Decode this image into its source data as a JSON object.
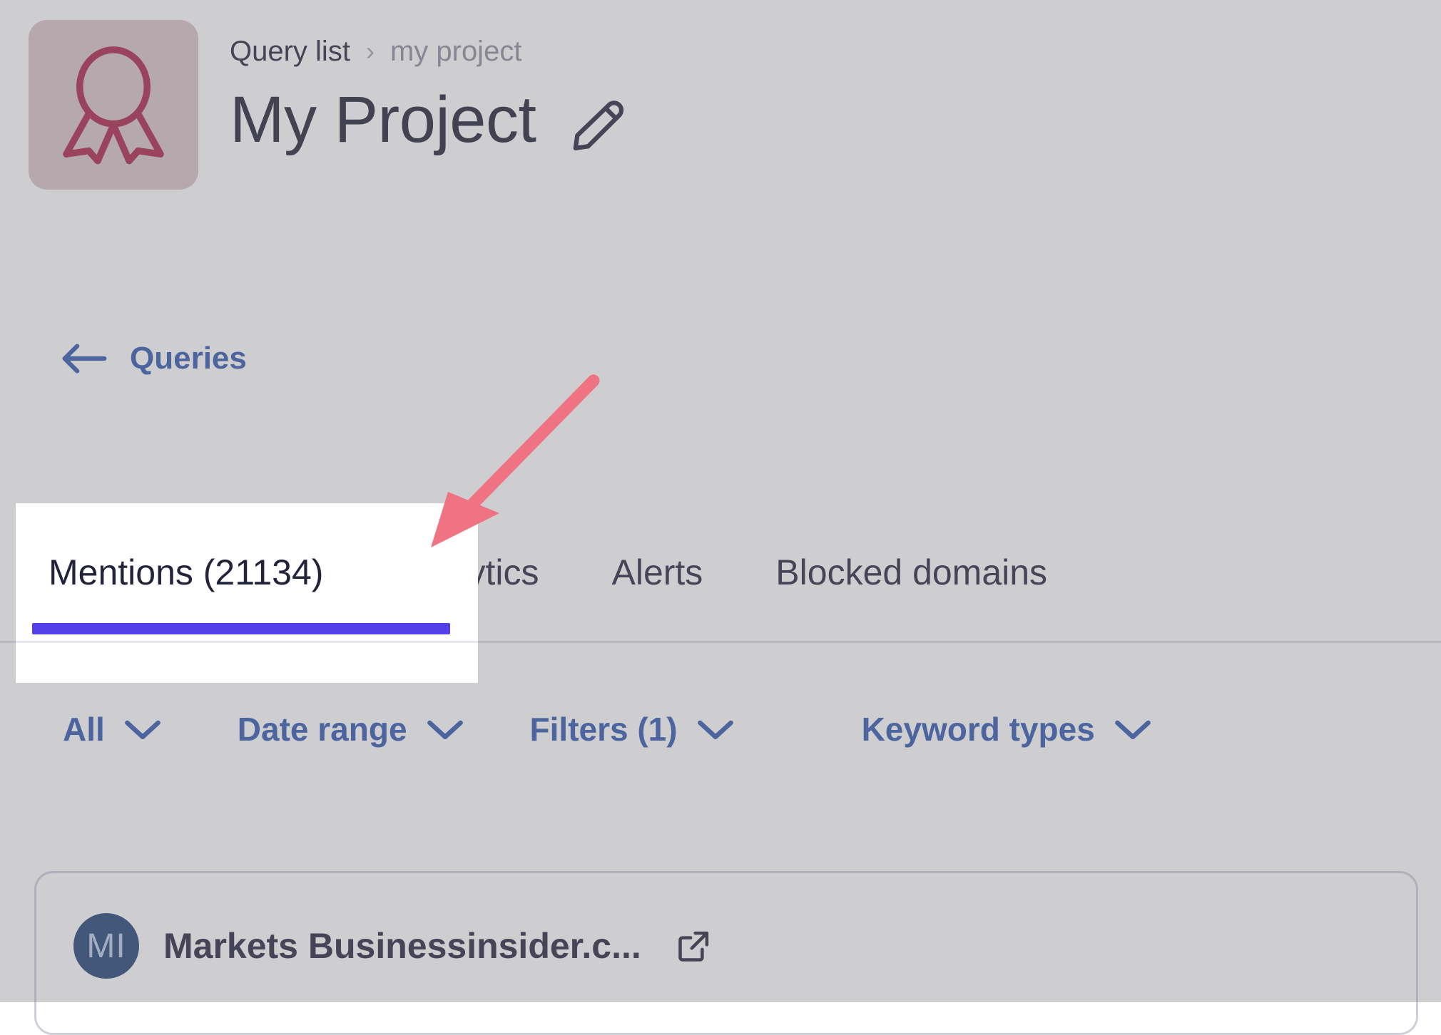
{
  "header": {
    "project_icon": "award-ribbon-icon",
    "breadcrumb": {
      "root": "Query list",
      "separator": "›",
      "current": "my project"
    },
    "title": "My Project",
    "edit_icon": "pencil-edit-icon"
  },
  "back_link": {
    "icon": "arrow-left-icon",
    "label": "Queries"
  },
  "tabs": [
    {
      "label": "Mentions (21134)",
      "active": true
    },
    {
      "label": "Analytics",
      "active": false
    },
    {
      "label": "Alerts",
      "active": false
    },
    {
      "label": "Blocked domains",
      "active": false
    }
  ],
  "filters": [
    {
      "label": "All",
      "icon": "chevron-down-icon"
    },
    {
      "label": "Date range",
      "icon": "chevron-down-icon"
    },
    {
      "label": "Filters (1)",
      "icon": "chevron-down-icon"
    },
    {
      "label": "Keyword types",
      "icon": "chevron-down-icon"
    }
  ],
  "mention": {
    "avatar_initials": "MI",
    "source_name": "Markets Businessinsider.c...",
    "external_link_icon": "external-link-icon"
  },
  "colors": {
    "accent_blue": "#2f56ae",
    "active_tab_underline": "#5340e8",
    "annotation_pink": "#ef7383",
    "project_tile_bg": "#d8c3c9",
    "project_icon": "#ab1f47",
    "avatar_bg": "#1d3f74",
    "text_dark": "#23233c"
  },
  "annotation": {
    "type": "arrow",
    "color": "#ef7383",
    "points_to": "Mentions (21134)"
  }
}
